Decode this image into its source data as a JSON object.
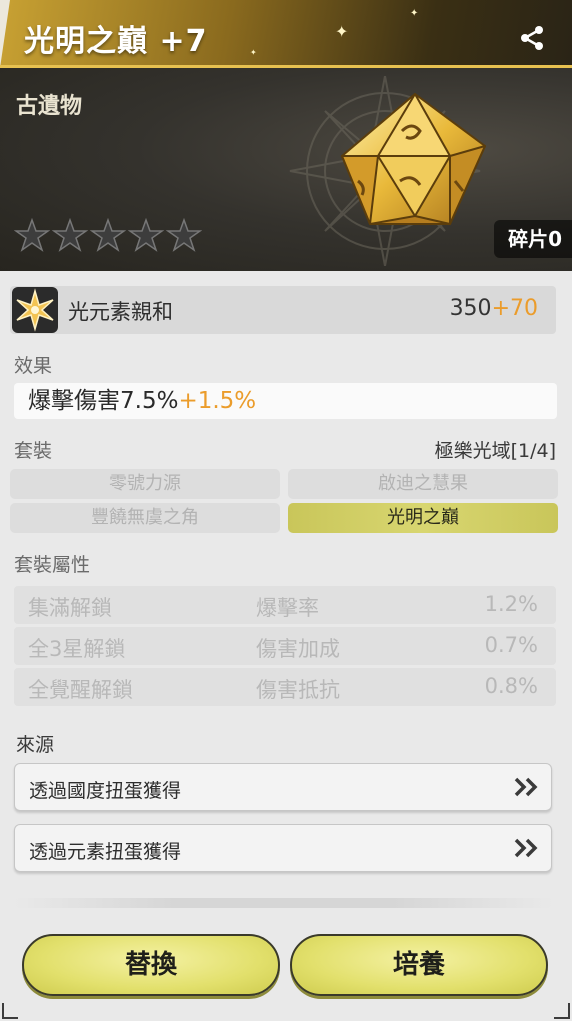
{
  "header": {
    "title": "光明之巔 +7",
    "share_icon": "share-icon"
  },
  "hero": {
    "item_type": "古遺物",
    "stars_total": 5,
    "stars_filled": 0,
    "shard_label": "碎片0"
  },
  "affinity": {
    "icon": "star-burst-icon",
    "name": "光元素親和",
    "base": "350",
    "bonus": "+70"
  },
  "effect": {
    "label": "效果",
    "text": "爆擊傷害7.5%",
    "bonus": "+1.5%"
  },
  "set": {
    "label": "套裝",
    "name": "極樂光域[1/4]",
    "pieces": [
      {
        "label": "零號力源",
        "active": false
      },
      {
        "label": "啟迪之慧果",
        "active": false
      },
      {
        "label": "豐饒無虞之角",
        "active": false
      },
      {
        "label": "光明之巔",
        "active": true
      }
    ]
  },
  "set_attrs": {
    "label": "套裝屬性",
    "rows": [
      {
        "condition": "集滿解鎖",
        "stat": "爆擊率",
        "value": "1.2%"
      },
      {
        "condition": "全3星解鎖",
        "stat": "傷害加成",
        "value": "0.7%"
      },
      {
        "condition": "全覺醒解鎖",
        "stat": "傷害抵抗",
        "value": "0.8%"
      }
    ]
  },
  "source": {
    "label": "來源",
    "items": [
      {
        "label": "透過國度扭蛋獲得",
        "icon": "double-chevron-right-icon"
      },
      {
        "label": "透過元素扭蛋獲得",
        "icon": "double-chevron-right-icon"
      }
    ]
  },
  "actions": {
    "replace": "替換",
    "train": "培養"
  },
  "colors": {
    "bonus": "#eb9c2b",
    "active_set": "#d8d670",
    "button": "#e2e06c",
    "header_gold": "#c9a233"
  }
}
